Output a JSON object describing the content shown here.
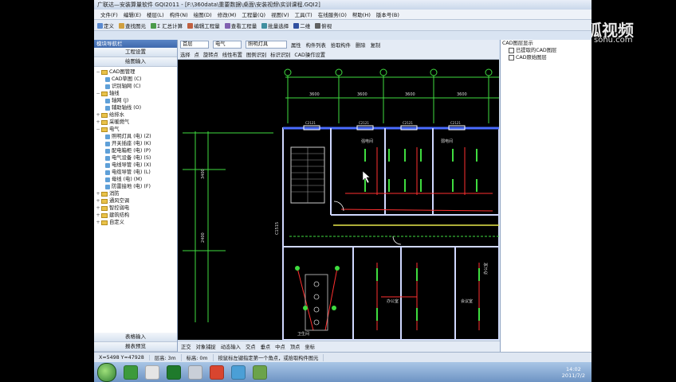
{
  "app": {
    "title": "广联达—安装算量软件 GQI2011 - [F:\\360data\\重要数据\\桌面\\安装视频\\实训课程.GQI2]"
  },
  "menu": [
    "文件(F)",
    "编辑(E)",
    "楼层(L)",
    "构件(N)",
    "绘图(D)",
    "修改(M)",
    "工程量(Q)",
    "视图(V)",
    "工具(T)",
    "在线服务(O)",
    "帮助(H)",
    "版本号(B)"
  ],
  "toolbar": {
    "items": [
      "定义",
      "查找图元",
      "Σ 汇总计算",
      "编辑工程量",
      "查看工程量",
      "批量选择",
      "二维",
      "俯视"
    ]
  },
  "left_pane": {
    "header": "模块导航栏",
    "btn_project": "工程设置",
    "btn_draw": "绘图输入",
    "tree": [
      {
        "label": "CAD图管理",
        "level": 0,
        "type": "folder",
        "expander": "−"
      },
      {
        "label": "CAD草图 (C)",
        "level": 1,
        "type": "leaf"
      },
      {
        "label": "识别轴网 (C)",
        "level": 1,
        "type": "leaf"
      },
      {
        "label": "轴线",
        "level": 0,
        "type": "folder",
        "expander": "−"
      },
      {
        "label": "轴网 (J)",
        "level": 1,
        "type": "leaf"
      },
      {
        "label": "辅助轴线 (O)",
        "level": 1,
        "type": "leaf"
      },
      {
        "label": "给排水",
        "level": 0,
        "type": "folder",
        "expander": "+"
      },
      {
        "label": "采暖燃气",
        "level": 0,
        "type": "folder",
        "expander": "+"
      },
      {
        "label": "电气",
        "level": 0,
        "type": "folder",
        "expander": "−"
      },
      {
        "label": "照明灯具 (电) (Z)",
        "level": 1,
        "type": "leaf"
      },
      {
        "label": "开关插座 (电) (K)",
        "level": 1,
        "type": "leaf"
      },
      {
        "label": "配电箱柜 (电) (P)",
        "level": 1,
        "type": "leaf"
      },
      {
        "label": "电气设备 (电) (S)",
        "level": 1,
        "type": "leaf"
      },
      {
        "label": "电线导管 (电) (X)",
        "level": 1,
        "type": "leaf"
      },
      {
        "label": "电缆导管 (电) (L)",
        "level": 1,
        "type": "leaf"
      },
      {
        "label": "母线 (电) (M)",
        "level": 1,
        "type": "leaf"
      },
      {
        "label": "防雷接地 (电) (F)",
        "level": 1,
        "type": "leaf"
      },
      {
        "label": "消防",
        "level": 0,
        "type": "folder",
        "expander": "+"
      },
      {
        "label": "通风空调",
        "level": 0,
        "type": "folder",
        "expander": "+"
      },
      {
        "label": "智控弱电",
        "level": 0,
        "type": "folder",
        "expander": "+"
      },
      {
        "label": "建筑结构",
        "level": 0,
        "type": "folder",
        "expander": "+"
      },
      {
        "label": "自定义",
        "level": 0,
        "type": "folder",
        "expander": "+"
      }
    ],
    "btn_table": "表格输入",
    "btn_report": "报表预览"
  },
  "canvas_toolbar": {
    "floor": "首层",
    "discipline": "电气",
    "component_type": "照明灯具",
    "row1": [
      "属性",
      "构件列表",
      "拾取构件",
      "删除",
      "复制"
    ],
    "row2": [
      "选择",
      "点",
      "旋转点",
      "线性布置",
      "图例识别",
      "标识识别",
      "CAD操作设置"
    ]
  },
  "status_toolbar": [
    "正交",
    "对象捕捉",
    "动态输入",
    "交点",
    "垂点",
    "中点",
    "顶点",
    "坐标"
  ],
  "right_pane": {
    "items": [
      "CAD图层显示",
      "已提取的CAD图层",
      "CAD原始图层"
    ]
  },
  "statusbar": {
    "coords": "X=5498 Y=47928",
    "floor_height": "层高: 3m",
    "base_height": "标高: 0m",
    "hint": "按鼠标左键指定第一个角点，或拾取构件图元"
  },
  "taskbar": {
    "time": "14:02",
    "date": "2011/7/2"
  },
  "watermark": {
    "brand1": "优酷",
    "brand2": "狐视频",
    "url": "sohu.com"
  },
  "cad": {
    "labels": [
      "3600",
      "3600",
      "3600",
      "C2121",
      "C2121",
      "C2121",
      "C2121",
      "3400",
      "2400",
      "强电间",
      "弱电间",
      "楼梯间",
      "卫生间",
      "办公室",
      "办公室",
      "会议室",
      "走廊",
      "C1515",
      "M0921",
      "LB1",
      "9000",
      "4700"
    ]
  }
}
